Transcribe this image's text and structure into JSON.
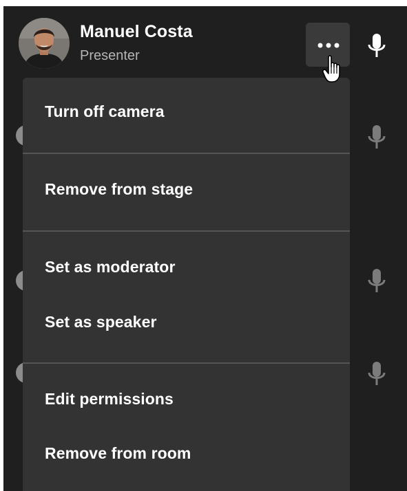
{
  "participant": {
    "name": "Manuel Costa",
    "role": "Presenter"
  },
  "icons": {
    "more": "more-horizontal-icon",
    "mic": "microphone-icon",
    "cursor": "hand-pointer-icon"
  },
  "colors": {
    "panel_background": "#1f1f1f",
    "menu_background": "#333333",
    "more_button_background": "#3a3a3a",
    "divider": "#555555",
    "mic_active": "#ffffff",
    "mic_muted": "#7c7c7c",
    "secondary_text": "#b5b5b5"
  },
  "menu": {
    "groups": [
      {
        "items": [
          "Turn off camera"
        ]
      },
      {
        "items": [
          "Remove from stage"
        ]
      },
      {
        "items": [
          "Set as moderator",
          "Set as speaker"
        ]
      },
      {
        "items": [
          "Edit permissions",
          "Remove from room"
        ]
      }
    ]
  }
}
